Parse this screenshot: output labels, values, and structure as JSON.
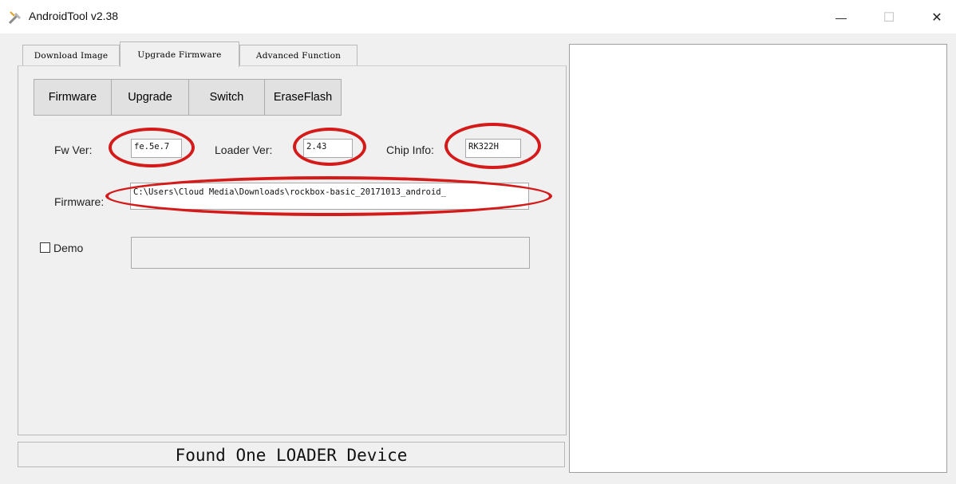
{
  "window": {
    "title": "AndroidTool v2.38",
    "minimize_glyph": "—",
    "maximize_glyph": "☐",
    "close_glyph": "✕"
  },
  "tabs": [
    {
      "label": "Download Image",
      "active": false
    },
    {
      "label": "Upgrade Firmware",
      "active": true
    },
    {
      "label": "Advanced Function",
      "active": false
    }
  ],
  "toolbar": {
    "firmware_label": "Firmware",
    "upgrade_label": "Upgrade",
    "switch_label": "Switch",
    "eraseflash_label": "EraseFlash"
  },
  "info": {
    "fw_ver_label": "Fw Ver:",
    "fw_ver_value": "fe.5e.7",
    "loader_ver_label": "Loader Ver:",
    "loader_ver_value": "2.43",
    "chip_info_label": "Chip Info:",
    "chip_info_value": "RK322H",
    "firmware_label": "Firmware:",
    "firmware_path": "C:\\Users\\Cloud Media\\Downloads\\rockbox-basic_20171013_android_"
  },
  "demo": {
    "label": "Demo",
    "checked": false,
    "value": ""
  },
  "status": {
    "message": "Found One LOADER Device"
  },
  "annotation": {
    "color": "#d51a1a"
  }
}
